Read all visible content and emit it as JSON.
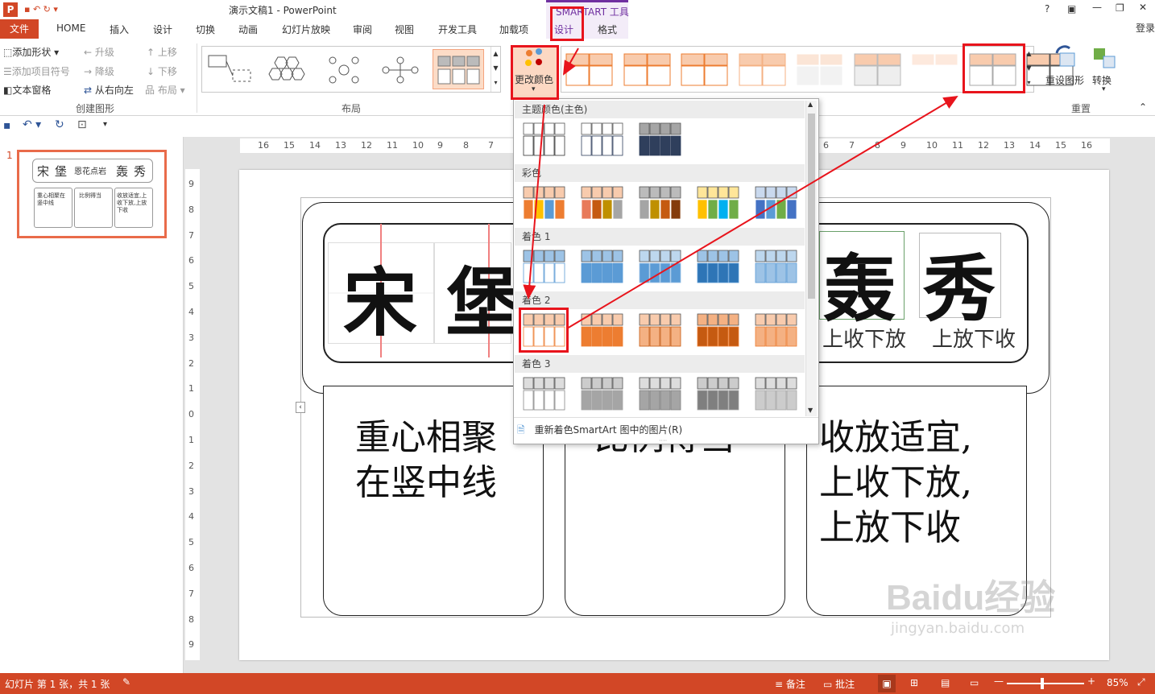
{
  "window": {
    "title": "演示文稿1 - PowerPoint",
    "help": "?",
    "controls": [
      "□",
      "—",
      "▫",
      "✕"
    ],
    "signin": "登录",
    "contextual_tab_group": "SMARTART 工具"
  },
  "tabs": [
    "文件",
    "HOME",
    "插入",
    "设计",
    "切换",
    "动画",
    "幻灯片放映",
    "审阅",
    "视图",
    "开发工具",
    "加载项",
    "设计",
    "格式"
  ],
  "ribbon": {
    "create_graphic": {
      "add_shape": "添加形状",
      "add_bullet": "添加项目符号",
      "text_pane": "文本窗格",
      "promote": "升级",
      "demote": "降级",
      "rtl": "从右向左",
      "move_up": "上移",
      "move_down": "下移",
      "layout": "布局",
      "label": "创建图形"
    },
    "layouts_label": "布局",
    "change_colors": "更改颜色",
    "reset": {
      "reset_graphic": "重设图形",
      "convert": "转换",
      "label": "重置"
    }
  },
  "color_dropdown": {
    "sections": [
      "主题颜色(主色)",
      "彩色",
      "着色 1",
      "着色 2",
      "着色 3"
    ],
    "footer": "重新着色SmartArt 图中的图片(R)",
    "colors": {
      "dark": "#2f3f5c",
      "accent1": "#5b9bd5",
      "accent2": "#ed7d31",
      "accent2_light": "#f8cbad",
      "gray": "#a5a5a5",
      "yellow": "#ffc000",
      "green": "#70ad47"
    }
  },
  "rulers": {
    "horizontal": [
      "16",
      "15",
      "14",
      "13",
      "12",
      "11",
      "10",
      "9",
      "8",
      "7",
      "6",
      "7",
      "8",
      "9",
      "10",
      "11",
      "12",
      "13",
      "14",
      "15",
      "16"
    ],
    "vertical": [
      "9",
      "8",
      "7",
      "6",
      "5",
      "4",
      "3",
      "2",
      "1",
      "0",
      "1",
      "2",
      "3",
      "4",
      "5",
      "6",
      "7",
      "8",
      "9"
    ]
  },
  "thumbnail": {
    "number": "1",
    "chars": [
      "宋",
      "堡",
      "恩花点岩",
      "轰",
      "秀"
    ],
    "texts": [
      "重心相聚在竖中线",
      "比例得当",
      "收放适宜,上收下放,上放下收"
    ]
  },
  "slide": {
    "chars": [
      "宋",
      "堡",
      "轰",
      "秀"
    ],
    "captions": [
      "上收下放",
      "上放下收"
    ],
    "box1": [
      "重心相聚",
      "在竖中线"
    ],
    "box2_visible": "比例得当",
    "box3": [
      "收放适宜,",
      "上收下放,",
      "上放下收"
    ]
  },
  "status": {
    "slide_info": "幻灯片 第 1 张，共 1 张",
    "notes": "备注",
    "comments": "批注",
    "zoom": "85%"
  },
  "watermark": {
    "logo": "Baidu经验",
    "url": "jingyan.baidu.com"
  }
}
